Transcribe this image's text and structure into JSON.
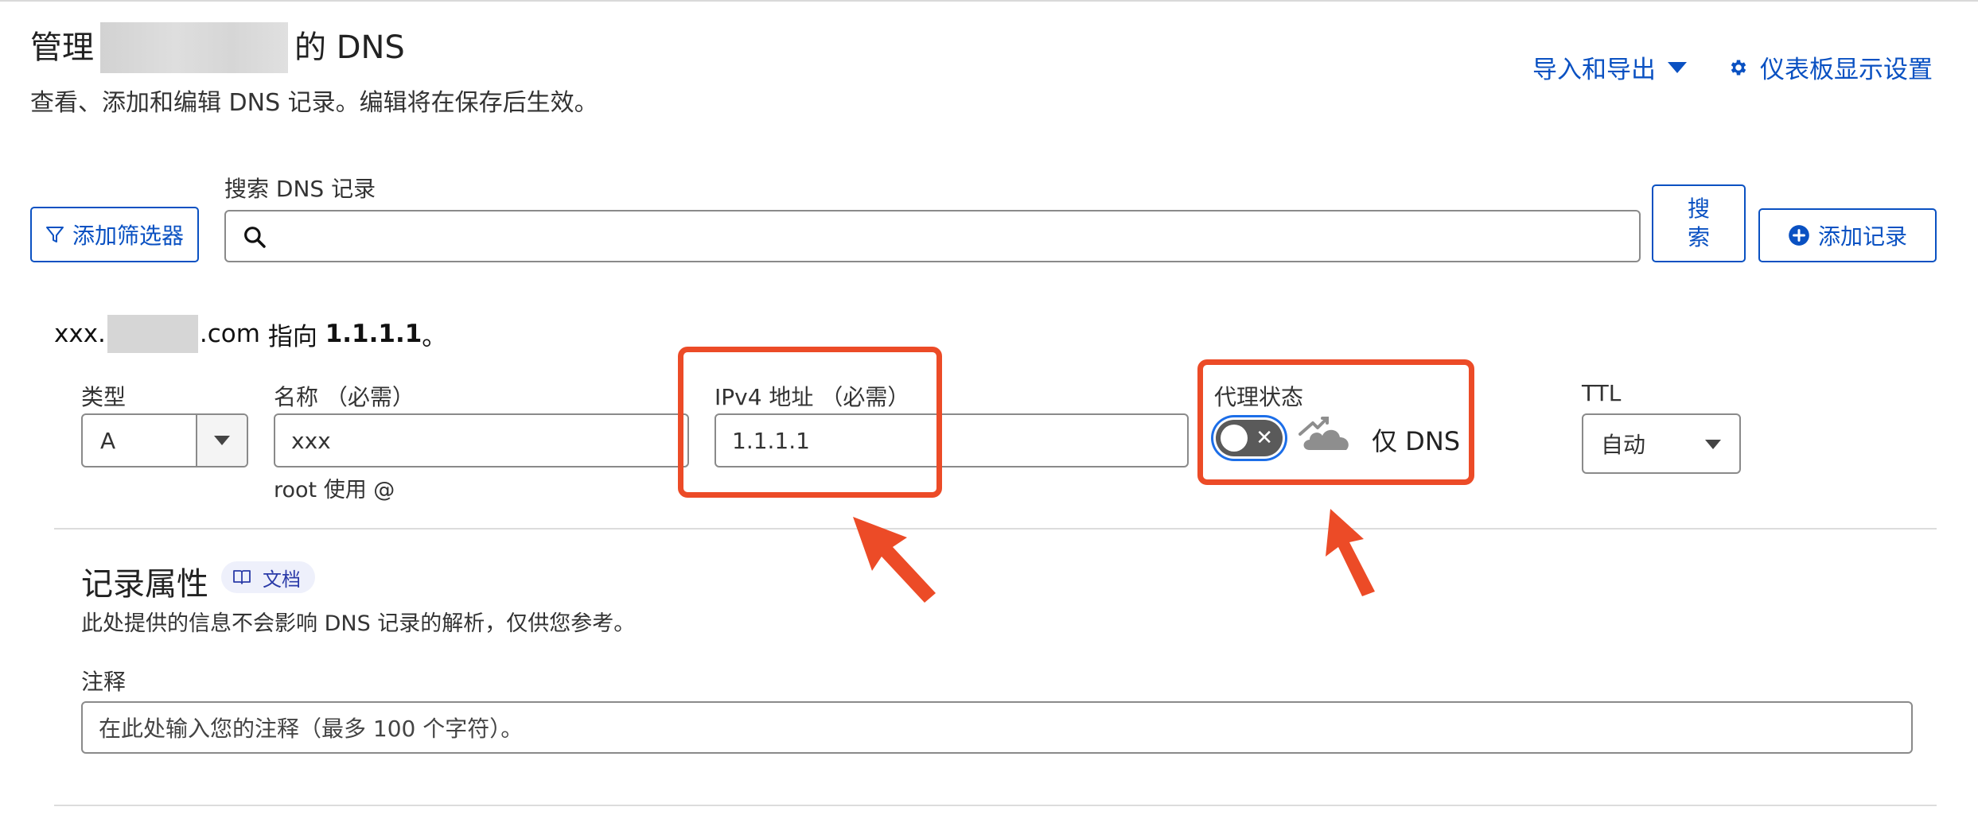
{
  "header": {
    "title_prefix": "管理",
    "title_suffix": "的 DNS",
    "subtitle": "查看、添加和编辑 DNS 记录。编辑将在保存后生效。",
    "import_export_label": "导入和导出",
    "dashboard_settings_label": "仪表板显示设置"
  },
  "toolbar": {
    "filter_label": "添加筛选器",
    "search_label": "搜索 DNS 记录",
    "search_value": "",
    "search_button_line1": "搜",
    "search_button_line2": "索",
    "add_record_label": "添加记录"
  },
  "record": {
    "points_prefix": "xxx.",
    "points_domain_suffix": ".com",
    "points_mid": " 指向 ",
    "points_target": "1.1.1.1",
    "points_end": "。",
    "type_label": "类型",
    "type_value": "A",
    "name_label": "名称 （必需）",
    "name_value": "xxx",
    "name_hint": "root 使用 @",
    "ipv4_label": "IPv4 地址 （必需）",
    "ipv4_value": "1.1.1.1",
    "proxy_label": "代理状态",
    "proxy_state": "仅 DNS",
    "proxy_enabled": false,
    "ttl_label": "TTL",
    "ttl_value": "自动"
  },
  "attributes": {
    "title": "记录属性",
    "doc_badge": "文档",
    "description": "此处提供的信息不会影响 DNS 记录的解析，仅供您参考。",
    "comment_label": "注释",
    "comment_placeholder": "在此处输入您的注释（最多 100 个字符）。"
  },
  "colors": {
    "accent": "#0a51c2",
    "annotation": "#ec4b27",
    "toggle_ring": "#1c6ee8"
  }
}
